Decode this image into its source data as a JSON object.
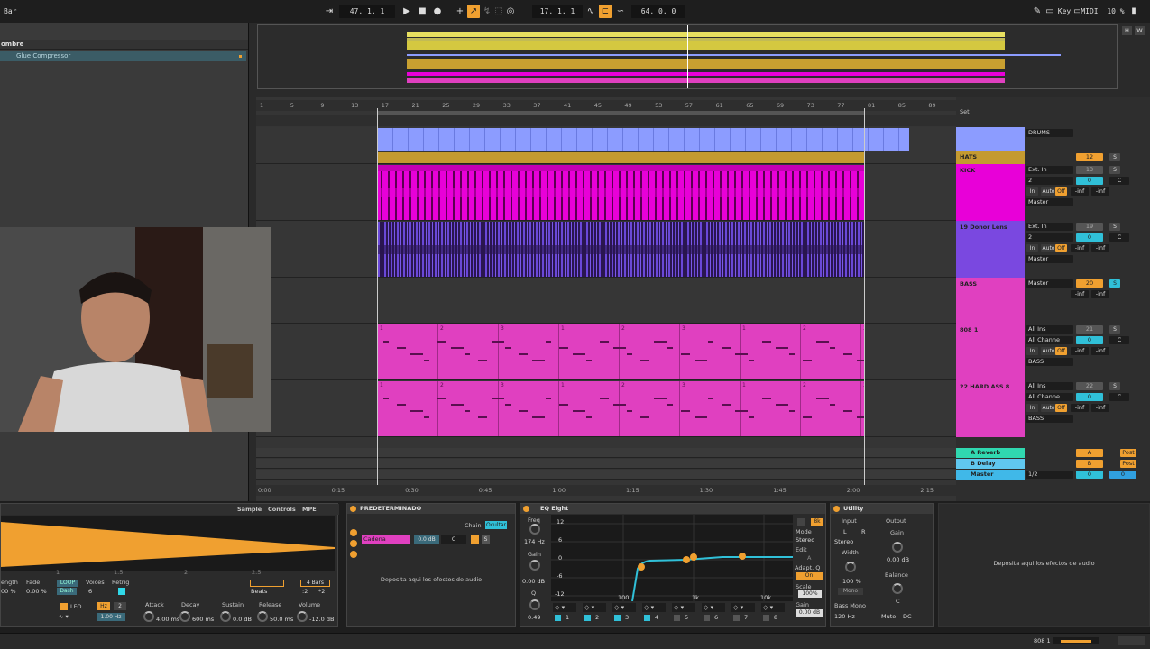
{
  "topbar": {
    "left_label": "Bar",
    "position": "47.  1.  1",
    "loop_start": "17.  1.  1",
    "loop_length": "64.  0.  0",
    "key": "Key",
    "midi": "MIDI",
    "cpu": "10 %"
  },
  "browser": {
    "header": "ombre",
    "device_item": "Glue Compressor"
  },
  "overview": {
    "h_label": "H",
    "w_label": "W"
  },
  "ruler": {
    "bars": [
      "1",
      "5",
      "9",
      "13",
      "17",
      "21",
      "25",
      "29",
      "33",
      "37",
      "41",
      "45",
      "49",
      "53",
      "57",
      "61",
      "65",
      "69",
      "73",
      "77",
      "81",
      "85",
      "89"
    ],
    "times": [
      "0:00",
      "0:15",
      "0:30",
      "0:45",
      "1:00",
      "1:15",
      "1:30",
      "1:45",
      "2:00",
      "2:15"
    ],
    "set_label": "Set"
  },
  "clip_numbers": [
    "1",
    "2",
    "3",
    "1",
    "2",
    "3",
    "1",
    "2",
    "3"
  ],
  "tracks": [
    {
      "name": "DRUMS",
      "routing": "DRUMS",
      "color": "#8c9cff"
    },
    {
      "name": "HATS",
      "num": "12",
      "color": "#c49a30"
    },
    {
      "name": "KICK",
      "input": "Ext. In",
      "channel": "2",
      "monitor": [
        "In",
        "Auto",
        "Off"
      ],
      "inf1": "-inf",
      "inf2": "-inf",
      "output": "Master",
      "num": "13",
      "vol": "0",
      "pan": "C",
      "color": "#e800d8"
    },
    {
      "name": "19 Donor Lens",
      "input": "Ext. In",
      "channel": "2",
      "monitor": [
        "In",
        "Auto",
        "Off"
      ],
      "inf1": "-inf",
      "inf2": "-inf",
      "output": "Master",
      "num": "19",
      "vol": "0",
      "pan": "C",
      "color": "#7a48e0"
    },
    {
      "name": "BASS",
      "output": "Master",
      "num": "20",
      "inf1": "-inf",
      "inf2": "-inf",
      "color": "#e040c0"
    },
    {
      "name": "808 1",
      "input": "All Ins",
      "channel": "All Channe",
      "monitor": [
        "In",
        "Auto",
        "Off"
      ],
      "inf1": "-inf",
      "inf2": "-inf",
      "output": "BASS",
      "num": "21",
      "vol": "0",
      "pan": "C",
      "color": "#e040c0"
    },
    {
      "name": "22 HARD ASS 8",
      "input": "All Ins",
      "channel": "All Channe",
      "monitor": [
        "In",
        "Auto",
        "Off"
      ],
      "inf1": "-inf",
      "inf2": "-inf",
      "output": "BASS",
      "num": "22",
      "vol": "0",
      "pan": "C",
      "color": "#e040c0"
    }
  ],
  "returns": [
    {
      "name": "A Reverb",
      "letter": "A",
      "post": "Post",
      "color": "#30d8b0"
    },
    {
      "name": "B Delay",
      "letter": "B",
      "post": "Post",
      "color": "#60c8f0"
    },
    {
      "name": "Master",
      "ratio": "1/2",
      "vol": "0",
      "pan": "0",
      "color": "#40b8e8"
    }
  ],
  "sampler": {
    "tabs": [
      "Sample",
      "Controls",
      "MPE"
    ],
    "labels": {
      "length": "ength",
      "fade": "Fade",
      "voices": "Voices",
      "retrig": "Retrig"
    },
    "values": {
      "length": "00 %",
      "fade": "0.00 %",
      "loop": "LOOP",
      "voices": "6",
      "mode": "Beats",
      "bars": "4 Bars",
      "m1": ":2",
      "m2": "*2",
      "snap": "Dash",
      "ticks": [
        "1",
        "1.5",
        "2",
        "2.5"
      ]
    },
    "lfo": "LFO",
    "lfo_rate": "1.00 Hz",
    "hz": "Hz",
    "lfo_num": "2",
    "env": [
      {
        "label": "Attack",
        "value": "4.00 ms"
      },
      {
        "label": "Decay",
        "value": "600 ms"
      },
      {
        "label": "Sustain",
        "value": "0.0 dB"
      },
      {
        "label": "Release",
        "value": "50.0 ms"
      },
      {
        "label": "Volume",
        "value": "-12.0 dB"
      }
    ]
  },
  "rack": {
    "title": "PREDETERMINADO",
    "chain": "Chain",
    "chain_btn": "Ocultar",
    "chain_name": "Cadena",
    "chain_gain": "0.0 dB",
    "chain_pan": "C",
    "chain_s": "S",
    "drop": "Deposita aqui los efectos de audio"
  },
  "eq": {
    "title": "EQ Eight",
    "freq_label": "Freq",
    "freq": "174 Hz",
    "gain_label": "Gain",
    "gain": "0.00 dB",
    "q_label": "Q",
    "q": "0.49",
    "db_scale": [
      "12",
      "6",
      "0",
      "-6",
      "-12"
    ],
    "freq_scale": [
      "100",
      "1k",
      "10k"
    ],
    "mode_label": "Mode",
    "mode": "Stereo",
    "edit": "Edit",
    "edit_val": "A",
    "adapt": "Adapt. Q",
    "adapt_val": "On",
    "scale": "Scale",
    "scale_val": "100%",
    "gain2": "Gain",
    "gain2_val": "0.00 dB",
    "bands": [
      "1",
      "2",
      "3",
      "4",
      "5",
      "6",
      "7",
      "8"
    ],
    "badge": "8k"
  },
  "utility": {
    "title": "Utility",
    "input": "Input",
    "output": "Output",
    "lr": [
      "L",
      "R"
    ],
    "mode": "Stereo",
    "width": "Width",
    "width_val": "100 %",
    "mono": "Mono",
    "bass_mono": "Bass Mono",
    "bass_freq": "120 Hz",
    "gain": "Gain",
    "gain_val": "0.00 dB",
    "balance": "Balance",
    "balance_val": "C",
    "mute": "Mute",
    "dc": "DC"
  },
  "drop_right": "Deposita aqui los efectos de audio",
  "status": {
    "track": "808 1"
  }
}
